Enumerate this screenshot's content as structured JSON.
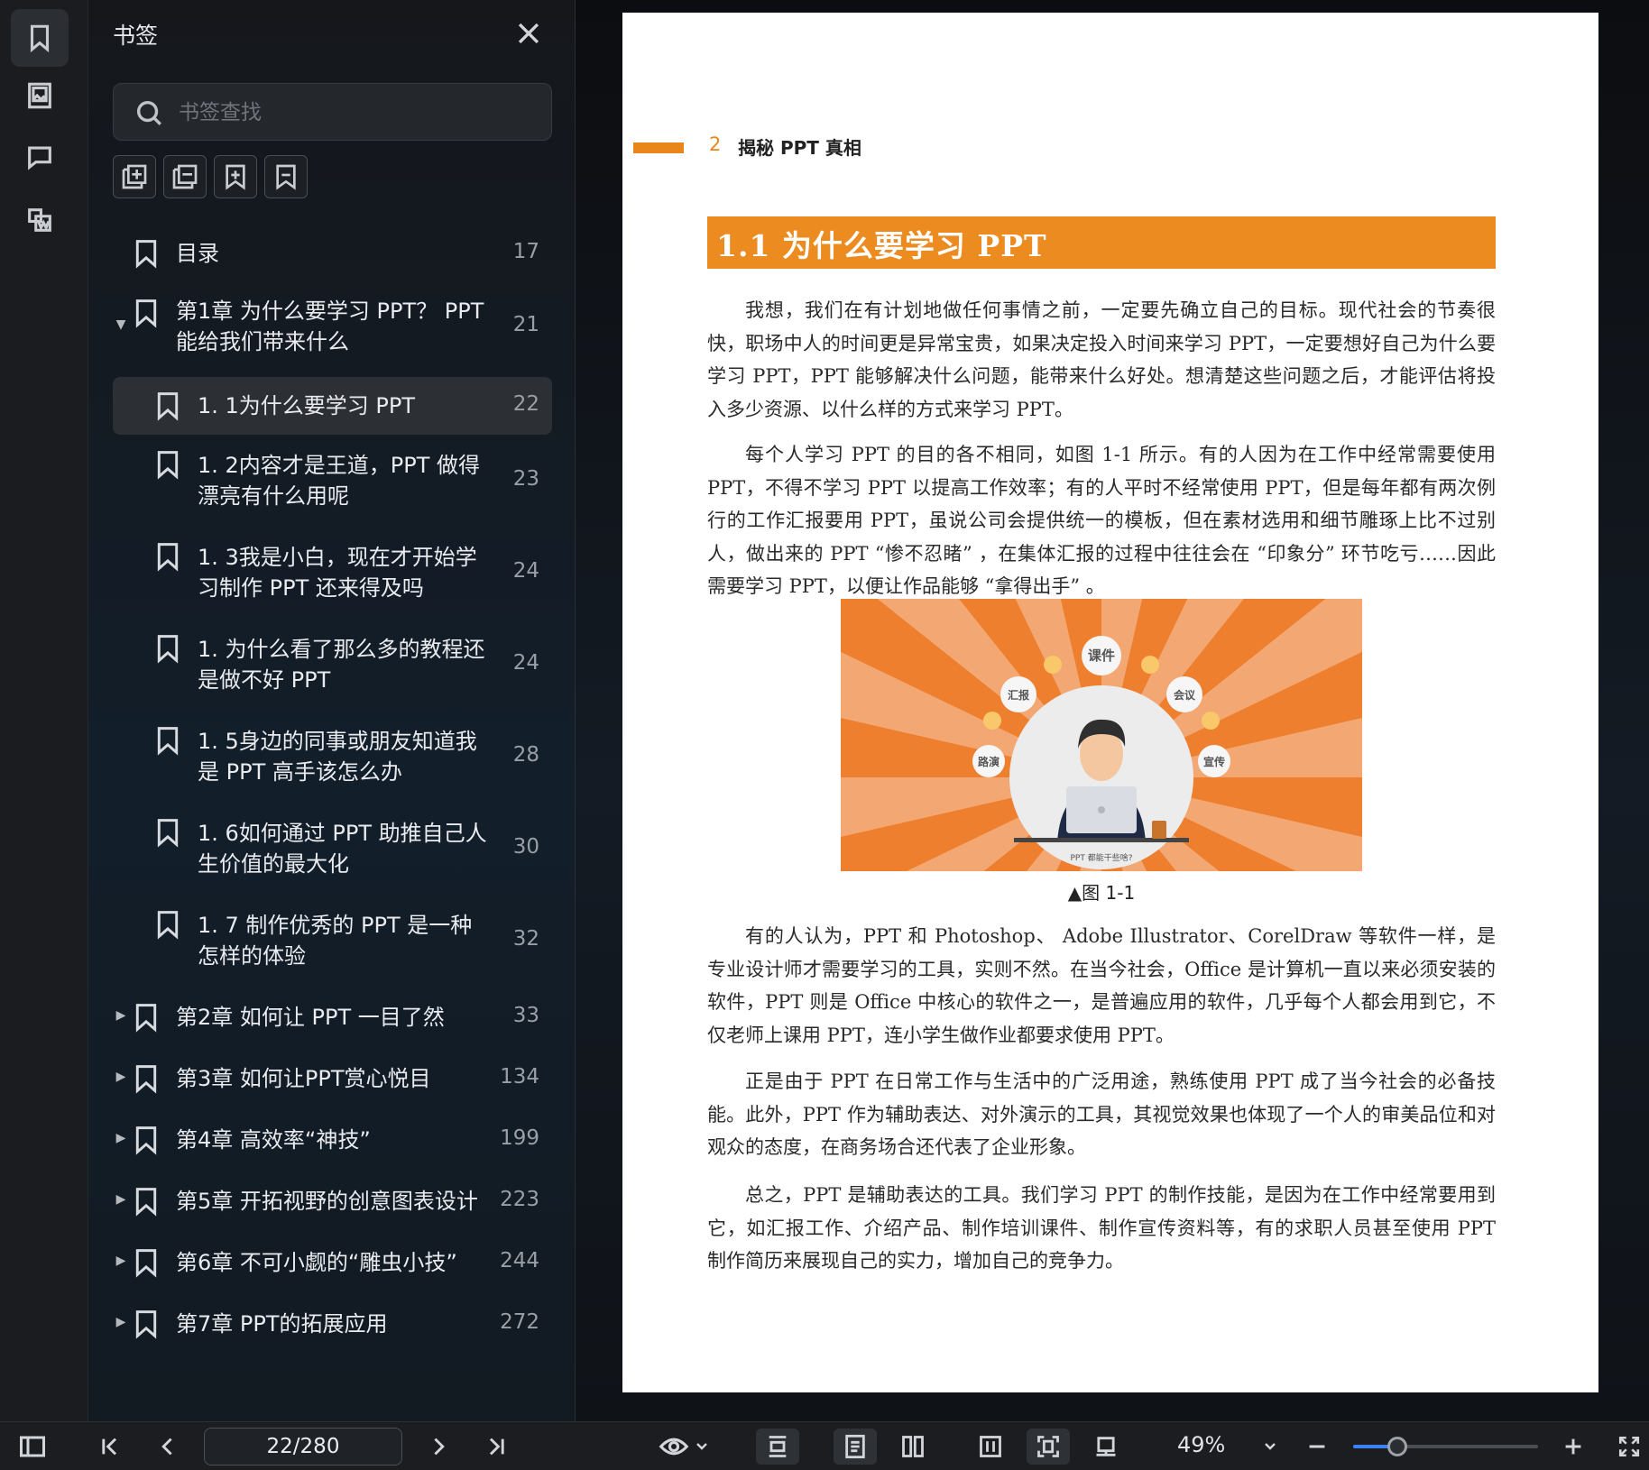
{
  "sidebar": {
    "title": "书签",
    "search_placeholder": "书签查找",
    "tools": [
      "add-bookmark-icon",
      "remove-bookmark-icon",
      "insert-bookmark-icon",
      "collapse-bookmark-icon"
    ],
    "items": [
      {
        "label": "目录",
        "page": "17",
        "level": 0,
        "caret": "",
        "lines": [
          "目录"
        ]
      },
      {
        "label": "第1章 为什么要学习 PPT？ PPT能给我们带来什么",
        "page": "21",
        "level": 0,
        "caret": "▼",
        "lines": [
          "第1章 为什么要学习 PPT？ PPT",
          "能给我们带来什么"
        ]
      },
      {
        "label": "1. 1为什么要学习 PPT",
        "page": "22",
        "level": 1,
        "caret": "",
        "selected": true,
        "lines": [
          "1. 1为什么要学习 PPT"
        ]
      },
      {
        "label": "1. 2内容才是王道，PPT 做得漂亮有什么用呢",
        "page": "23",
        "level": 1,
        "caret": "",
        "lines": [
          "1. 2内容才是王道，PPT 做得",
          "漂亮有什么用呢"
        ]
      },
      {
        "label": "1. 3我是小白，现在才开始学习制作 PPT 还来得及吗",
        "page": "24",
        "level": 1,
        "caret": "",
        "lines": [
          "1. 3我是小白，现在才开始学",
          "习制作 PPT 还来得及吗"
        ]
      },
      {
        "label": "1. 为什么看了那么多的教程还是做不好 PPT",
        "page": "24",
        "level": 1,
        "caret": "",
        "lines": [
          "1. 为什么看了那么多的教程还",
          "是做不好 PPT"
        ]
      },
      {
        "label": "1. 5身边的同事或朋友知道我是 PPT 高手该怎么办",
        "page": "28",
        "level": 1,
        "caret": "",
        "lines": [
          "1. 5身边的同事或朋友知道我",
          "是 PPT 高手该怎么办"
        ]
      },
      {
        "label": "1. 6如何通过 PPT 助推自己人生价值的最大化",
        "page": "30",
        "level": 1,
        "caret": "",
        "lines": [
          "1. 6如何通过 PPT 助推自己人",
          "生价值的最大化"
        ]
      },
      {
        "label": "1. 7 制作优秀的 PPT 是一种怎样的体验",
        "page": "32",
        "level": 1,
        "caret": "",
        "lines": [
          "1. 7 制作优秀的 PPT 是一种",
          "怎样的体验"
        ]
      },
      {
        "label": "第2章 如何让 PPT 一目了然",
        "page": "33",
        "level": 0,
        "caret": "▶",
        "lines": [
          "第2章 如何让 PPT 一目了然"
        ]
      },
      {
        "label": "第3章 如何让PPT赏心悦目",
        "page": "134",
        "level": 0,
        "caret": "▶",
        "lines": [
          "第3章 如何让PPT赏心悦目"
        ]
      },
      {
        "label": "第4章 高效率“神技”",
        "page": "199",
        "level": 0,
        "caret": "▶",
        "lines": [
          "第4章 高效率“神技”"
        ]
      },
      {
        "label": "第5章 开拓视野的创意图表设计",
        "page": "223",
        "level": 0,
        "caret": "▶",
        "lines": [
          "第5章 开拓视野的创意图表设计"
        ]
      },
      {
        "label": "第6章 不可小觑的“雕虫小技”",
        "page": "244",
        "level": 0,
        "caret": "▶",
        "lines": [
          "第6章 不可小觑的“雕虫小技”"
        ]
      },
      {
        "label": "第7章 PPT的拓展应用",
        "page": "272",
        "level": 0,
        "caret": "▶",
        "lines": [
          "第7章 PPT的拓展应用"
        ]
      }
    ]
  },
  "rail": {
    "items": [
      "bookmark-icon",
      "image-icon",
      "comment-icon",
      "ocr-icon"
    ]
  },
  "document": {
    "running_number": "2",
    "running_title": "揭秘 PPT 真相",
    "section_title": "1.1  为什么要学习 PPT",
    "paragraphs": [
      "我想，我们在有计划地做任何事情之前，一定要先确立自己的目标。现代社会的节奏很快，职场中人的时间更是异常宝贵，如果决定投入时间来学习 PPT，一定要想好自己为什么要学习 PPT，PPT 能够解决什么问题，能带来什么好处。想清楚这些问题之后，才能评估将投入多少资源、以什么样的方式来学习 PPT。",
      "每个人学习 PPT 的目的各不相同，如图 1-1 所示。有的人因为在工作中经常需要使用 PPT，不得不学习 PPT 以提高工作效率；有的人平时不经常使用 PPT，但是每年都有两次例行的工作汇报要用 PPT，虽说公司会提供统一的模板，但在素材选用和细节雕琢上比不过别人，做出来的 PPT “惨不忍睹” ，在集体汇报的过程中往往会在 “印象分” 环节吃亏……因此需要学习 PPT，以便让作品能够 “拿得出手” 。",
      "有的人认为，PPT 和 Photoshop、 Adobe Illustrator、CorelDraw 等软件一样，是专业设计师才需要学习的工具，实则不然。在当今社会，Office 是计算机一直以来必须安装的软件，PPT 则是 Office 中核心的软件之一，是普遍应用的软件，几乎每个人都会用到它，不仅老师上课用 PPT，连小学生做作业都要求使用 PPT。",
      "正是由于 PPT 在日常工作与生活中的广泛用途，熟练使用 PPT 成了当今社会的必备技能。此外，PPT 作为辅助表达、对外演示的工具，其视觉效果也体现了一个人的审美品位和对观众的态度，在商务场合还代表了企业形象。",
      "总之，PPT 是辅助表达的工具。我们学习 PPT 的制作技能，是因为在工作中经常要用到它，如汇报工作、介绍产品、制作培训课件、制作宣传资料等，有的求职人员甚至使用 PPT 制作简历来展现自己的实力，增加自己的竞争力。"
    ],
    "figure": {
      "caption": "▲图 1-1",
      "bubbles": [
        "课件",
        "汇报",
        "会议",
        "路演",
        "宣传"
      ],
      "desk_caption": "PPT 都能干些啥?"
    }
  },
  "bottombar": {
    "page_indicator": "22/280",
    "zoom": "49%",
    "zoom_fraction": 0.24,
    "accent": "#3b82f6"
  }
}
